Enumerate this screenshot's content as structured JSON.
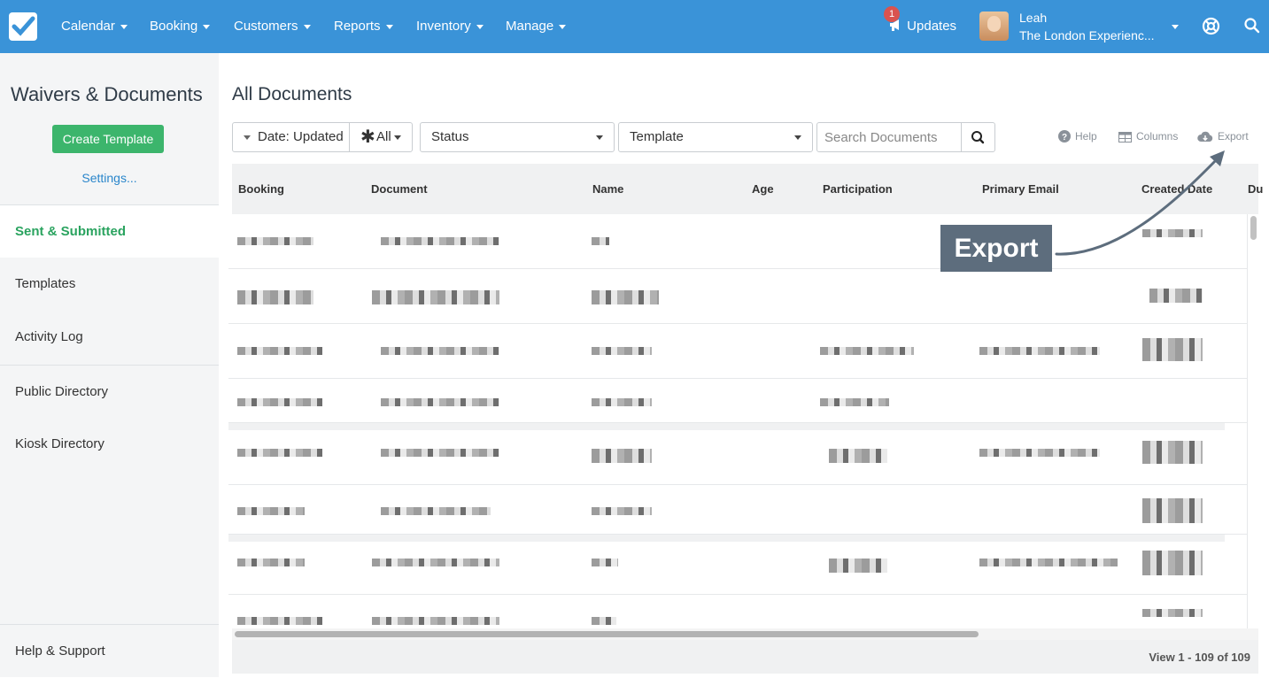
{
  "nav": {
    "items": [
      "Calendar",
      "Booking",
      "Customers",
      "Reports",
      "Inventory",
      "Manage"
    ],
    "updates_label": "Updates",
    "updates_badge": "1",
    "user_name": "Leah",
    "user_org": "The London Experienc..."
  },
  "sidebar": {
    "title": "Waivers & Documents",
    "create_button": "Create Template",
    "settings_link": "Settings...",
    "items": [
      "Sent & Submitted",
      "Templates",
      "Activity Log",
      "Public Directory",
      "Kiosk Directory"
    ],
    "active_item": "Sent & Submitted",
    "footer_item": "Help & Support"
  },
  "main": {
    "title": "All Documents",
    "filters": {
      "date": "Date: Updated",
      "all": "All",
      "status": "Status",
      "template": "Template",
      "search_placeholder": "Search Documents"
    },
    "tools": {
      "help": "Help",
      "columns": "Columns",
      "export": "Export"
    },
    "table": {
      "columns": [
        "Booking",
        "Document",
        "Name",
        "Age",
        "Participation",
        "Primary Email",
        "Created Date",
        "Du"
      ]
    },
    "pagination": "View 1 - 109 of 109"
  },
  "annotation": {
    "callout": "Export"
  },
  "colors": {
    "nav_bg": "#3a93d8",
    "primary_green": "#3cb56c",
    "link_blue": "#2a86cb",
    "callout_bg": "#5d6d7d"
  }
}
